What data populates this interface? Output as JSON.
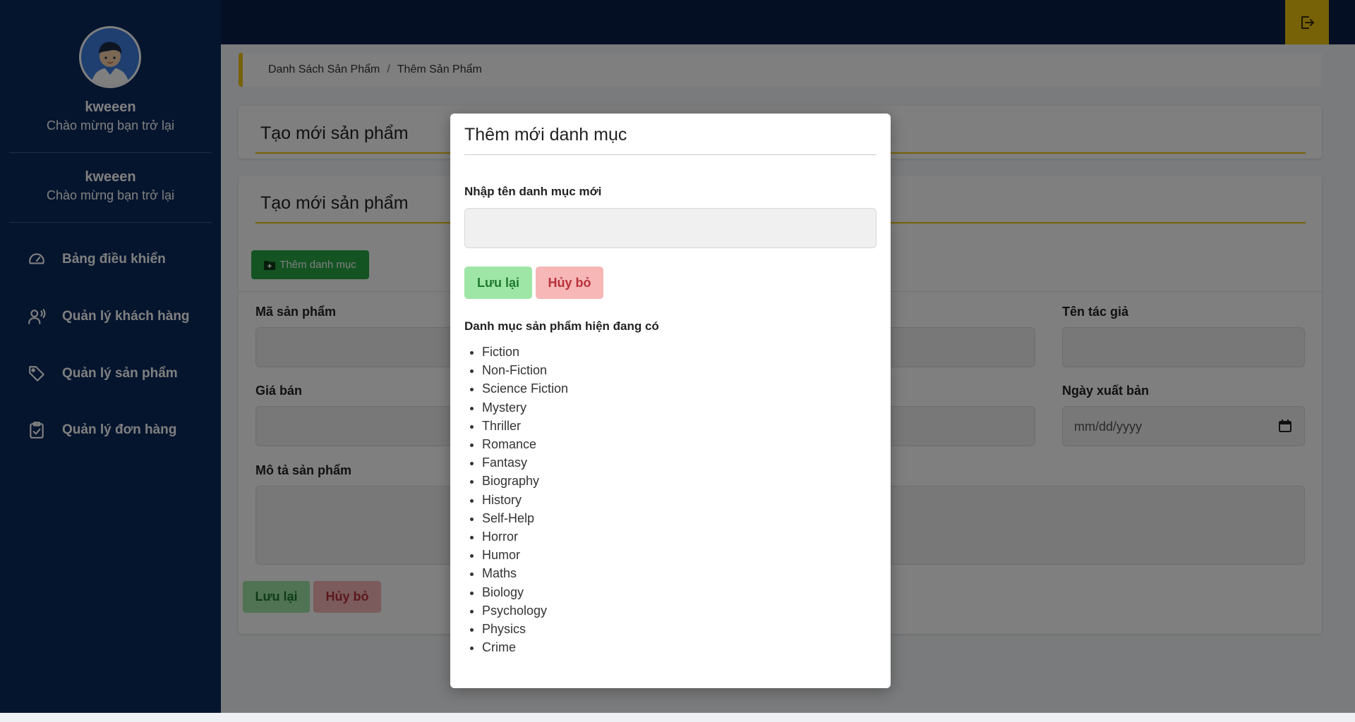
{
  "sidebar": {
    "profile": {
      "name": "kweeen",
      "greeting": "Chào mừng bạn trở lại"
    },
    "profile_repeat": {
      "name": "kweeen",
      "greeting": "Chào mừng bạn trở lại"
    },
    "items": [
      {
        "label": "Bảng điều khiển",
        "icon": "gauge-icon"
      },
      {
        "label": "Quản lý khách hàng",
        "icon": "user-voice-icon"
      },
      {
        "label": "Quản lý sản phẩm",
        "icon": "tag-icon"
      },
      {
        "label": "Quản lý đơn hàng",
        "icon": "clipboard-check-icon"
      }
    ]
  },
  "topbar": {
    "logout_icon": "logout-icon"
  },
  "breadcrumb": {
    "parent": "Danh Sách Sản Phẩm",
    "separator": "/",
    "current": "Thêm Sản Phẩm"
  },
  "page": {
    "card1_title": "Tạo mới sản phẩm",
    "card2_title": "Tạo mới sản phẩm",
    "add_category_button": "Thêm danh mục",
    "fields": {
      "product_code": "Mã sản phẩm",
      "author": "Tên tác giả",
      "price": "Giá bán",
      "publish_date": "Ngày xuất bản",
      "description": "Mô tả sản phẩm"
    },
    "date_placeholder": "mm/dd/yyyy",
    "save_button": "Lưu lại",
    "cancel_button": "Hủy bỏ"
  },
  "modal": {
    "title": "Thêm mới danh mục",
    "input_label": "Nhập tên danh mục mới",
    "input_value": "",
    "save_button": "Lưu lại",
    "cancel_button": "Hủy bỏ",
    "list_title": "Danh mục sản phẩm hiện đang có",
    "categories": [
      "Fiction",
      "Non-Fiction",
      "Science Fiction",
      "Mystery",
      "Thriller",
      "Romance",
      "Fantasy",
      "Biography",
      "History",
      "Self-Help",
      "Horror",
      "Humor",
      "Maths",
      "Biology",
      "Psychology",
      "Physics",
      "Crime"
    ]
  },
  "colors": {
    "sidebar": "#0a2a5c",
    "topbar": "#0b1f48",
    "accent": "#f1c40f",
    "success": "#28a745",
    "danger": "#b8323a"
  }
}
